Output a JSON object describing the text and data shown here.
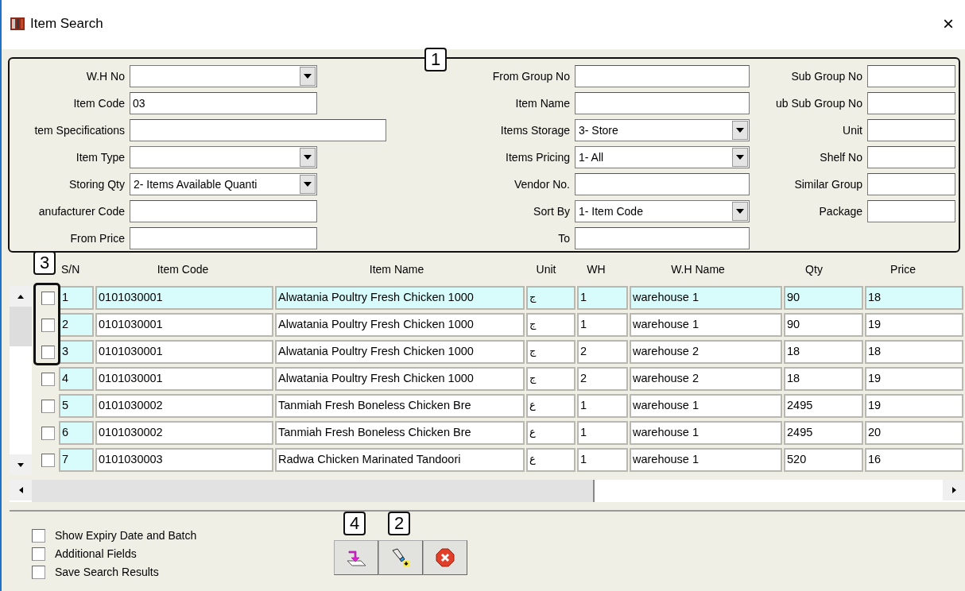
{
  "window": {
    "title": "Item Search",
    "close": "×"
  },
  "filter_panel": {
    "callout": "1",
    "columns": [
      {
        "fields": [
          {
            "label": "W.H No",
            "kind": "combo"
          },
          {
            "label": "Item Code",
            "kind": "text",
            "value": "03"
          },
          {
            "label": "tem Specifications",
            "kind": "wide"
          },
          {
            "label": "Item Type",
            "kind": "combo"
          },
          {
            "label": "Storing Qty",
            "kind": "combo",
            "value": "2- Items Available Quanti"
          },
          {
            "label": "anufacturer Code",
            "kind": "text"
          },
          {
            "label": "From Price",
            "kind": "text"
          }
        ]
      },
      {
        "fields": [
          {
            "label": "From Group No",
            "kind": "text"
          },
          {
            "label": "Item Name",
            "kind": "text"
          },
          {
            "label": "Items Storage",
            "kind": "combo",
            "value": "3- Store"
          },
          {
            "label": "Items Pricing",
            "kind": "combo",
            "value": "1- All"
          },
          {
            "label": "Vendor No.",
            "kind": "text"
          },
          {
            "label": "Sort By",
            "kind": "combo",
            "value": "1- Item Code"
          },
          {
            "label": "To",
            "kind": "text"
          }
        ]
      },
      {
        "fields": [
          {
            "label": "Sub Group No",
            "kind": "text"
          },
          {
            "label": "ub Sub Group No",
            "kind": "text"
          },
          {
            "label": "Unit",
            "kind": "text"
          },
          {
            "label": "Shelf No",
            "kind": "text"
          },
          {
            "label": "Similar Group",
            "kind": "text"
          },
          {
            "label": "Package",
            "kind": "text"
          }
        ]
      }
    ]
  },
  "grid": {
    "checkbox_callout": "3",
    "columns": [
      "S/N",
      "Item Code",
      "Item Name",
      "Unit",
      "WH",
      "W.H Name",
      "Qty",
      "Price"
    ],
    "rows": [
      {
        "selected": true,
        "checked": false,
        "cells": [
          "1",
          "0101030001",
          "Alwatania Poultry Fresh Chicken 1000",
          "ج",
          "1",
          "warehouse 1",
          "90",
          "18"
        ]
      },
      {
        "selected": false,
        "checked": false,
        "cells": [
          "2",
          "0101030001",
          "Alwatania Poultry Fresh Chicken 1000",
          "ج",
          "1",
          "warehouse 1",
          "90",
          "19"
        ]
      },
      {
        "selected": false,
        "checked": false,
        "cells": [
          "3",
          "0101030001",
          "Alwatania Poultry Fresh Chicken 1000",
          "ج",
          "2",
          "warehouse 2",
          "18",
          "18"
        ]
      },
      {
        "selected": false,
        "checked": false,
        "cells": [
          "4",
          "0101030001",
          "Alwatania Poultry Fresh Chicken 1000",
          "ج",
          "2",
          "warehouse 2",
          "18",
          "19"
        ]
      },
      {
        "selected": false,
        "checked": false,
        "cells": [
          "5",
          "0101030002",
          "Tanmiah Fresh Boneless Chicken Bre",
          "ع",
          "1",
          "warehouse 1",
          "2495",
          "19"
        ]
      },
      {
        "selected": false,
        "checked": false,
        "cells": [
          "6",
          "0101030002",
          "Tanmiah Fresh Boneless Chicken Bre",
          "ع",
          "1",
          "warehouse 1",
          "2495",
          "20"
        ]
      },
      {
        "selected": false,
        "checked": false,
        "cells": [
          "7",
          "0101030003",
          "Radwa Chicken Marinated Tandoori",
          "ع",
          "1",
          "warehouse 1",
          "520",
          "16"
        ]
      }
    ]
  },
  "options": [
    {
      "label": "Show Expiry Date and Batch",
      "checked": false
    },
    {
      "label": "Additional Fields",
      "checked": false
    },
    {
      "label": "Save Search Results",
      "checked": false
    }
  ],
  "buttons": [
    {
      "kind": "import",
      "callout": "4"
    },
    {
      "kind": "search",
      "callout": "2"
    },
    {
      "kind": "cancel"
    }
  ]
}
